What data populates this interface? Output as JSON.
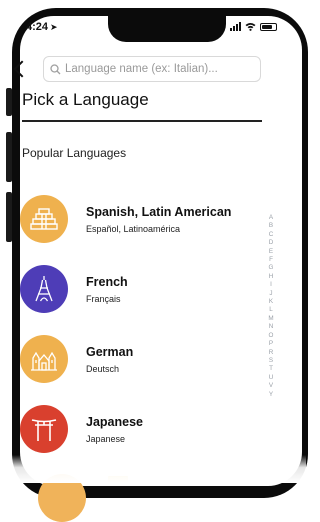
{
  "status_bar": {
    "time": "4:24",
    "location_glyph": "➤"
  },
  "search": {
    "placeholder": "Language name (ex: Italian)..."
  },
  "page": {
    "title": "Pick a Language",
    "section_title": "Popular Languages"
  },
  "languages": [
    {
      "name": "Spanish, Latin American",
      "native": "Español, Latinoamérica",
      "icon": "pyramid-icon",
      "color": "#EFB14E"
    },
    {
      "name": "French",
      "native": "Français",
      "icon": "eiffel-tower-icon",
      "color": "#4E3DB7"
    },
    {
      "name": "German",
      "native": "Deutsch",
      "icon": "castle-icon",
      "color": "#EFB14E"
    },
    {
      "name": "Japanese",
      "native": "Japanese",
      "icon": "torii-gate-icon",
      "color": "#D9402E"
    }
  ],
  "alphabet_index": [
    "A",
    "B",
    "C",
    "D",
    "E",
    "F",
    "G",
    "H",
    "I",
    "J",
    "K",
    "L",
    "M",
    "N",
    "O",
    "P",
    "R",
    "S",
    "T",
    "U",
    "V",
    "Y"
  ]
}
